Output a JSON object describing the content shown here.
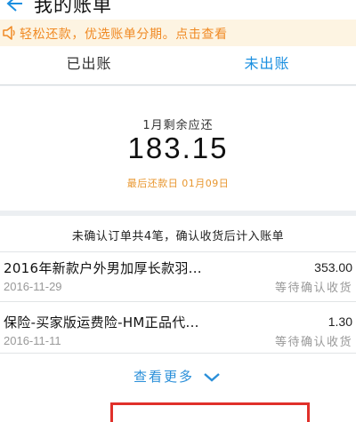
{
  "header": {
    "title": "我的账单",
    "back_icon": "back-arrow-icon"
  },
  "notice": {
    "icon": "speaker-icon",
    "text": "轻松还款，优选账单分期。点击查看",
    "color": "#f08a24"
  },
  "tabs": [
    {
      "label": "已出账",
      "active": false
    },
    {
      "label": "未出账",
      "active": true
    }
  ],
  "summary": {
    "label": "1月剩余应还",
    "amount": "183.15",
    "due_date": "最后还款日 01月09日"
  },
  "orders": {
    "notice": "未确认订单共4笔，确认收货后计入账单",
    "items": [
      {
        "name": "2016年新款户外男加厚长款羽...",
        "amount": "353.00",
        "date": "2016-11-29",
        "status": "等待确认收货"
      },
      {
        "name": "保险-买家版运费险-HM正品代...",
        "amount": "1.30",
        "date": "2016-11-11",
        "status": "等待确认收货"
      }
    ],
    "more_label": "查看更多",
    "more_icon": "chevron-down-icon"
  },
  "colors": {
    "accent": "#1a8fe0",
    "notice_bg": "#fdf4e2",
    "highlight_box": "#e0302a"
  }
}
